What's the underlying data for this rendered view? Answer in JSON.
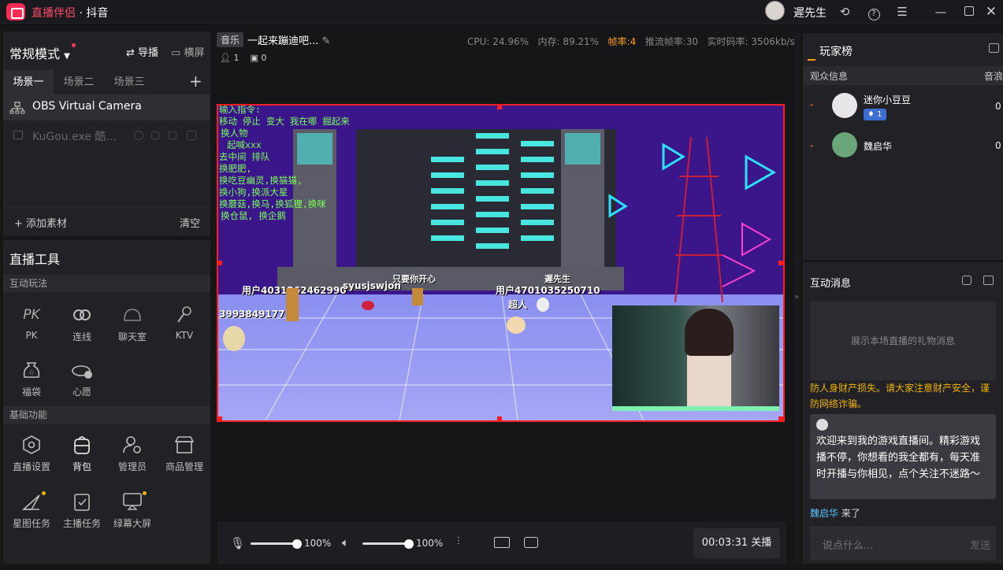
{
  "app": {
    "name": "直播伴侣",
    "subtitle": "· 抖音"
  },
  "user": {
    "name": "遲先生"
  },
  "left": {
    "mode": "常规模式",
    "guide_label": "导播",
    "landscape_label": "横屏",
    "scene_tabs": [
      "场景一",
      "场景二",
      "场景三"
    ],
    "sources": [
      {
        "name": "OBS Virtual Camera"
      },
      {
        "name": "KuGou.exe 酷..."
      }
    ],
    "add_source": "添加素材",
    "clear": "清空",
    "tools_title": "直播工具",
    "section_interactive": "互动玩法",
    "interactive": [
      "PK",
      "连线",
      "聊天室",
      "KTV",
      "福袋",
      "心愿"
    ],
    "section_basic": "基础功能",
    "basic": [
      "直播设置",
      "背包",
      "管理员",
      "商品管理",
      "星图任务",
      "主播任务",
      "绿幕大屏"
    ]
  },
  "center": {
    "music_tag": "音乐",
    "title": "一起来蹦迪吧...",
    "cpu": "CPU: 24.96%",
    "mem": "内存: 89.21%",
    "fps": "帧率:4",
    "push_fps": "推流帧率:30",
    "bitrate": "实时码率: 3506kb/s",
    "viewers": "1",
    "gifts": "0",
    "preview": {
      "cmd_lines": [
        "输入指令:",
        "移动 停止 变大 我在哪 掘起来",
        "换人物",
        "起喊xxx",
        "去中间 排队",
        "换肥肥,",
        "换吃豆幽灵,换猫猫,",
        "换小狗,换派大星",
        "换蘑菇,换马,换狐狸,换咪",
        "换仓鼠, 换企鹅"
      ],
      "labels": [
        "用户4031262462990",
        "syusjswjoh",
        "只要你开心",
        "遲先生",
        "用户4701035250710",
        "超人",
        "3993849177"
      ]
    },
    "mic_volume": "100%",
    "speaker_volume": "100%",
    "timer": "00:03:31 关播"
  },
  "right": {
    "leaderboard_title": "玩家榜",
    "col_audience": "观众信息",
    "col_score": "音浪",
    "players": [
      {
        "rank": "-",
        "name": "迷你小豆豆",
        "badge": "1",
        "score": "0"
      },
      {
        "rank": "-",
        "name": "魏启华",
        "badge": "",
        "score": "0"
      }
    ],
    "messages_title": "互动消息",
    "gift_placeholder": "展示本场直播的礼物消息",
    "warning": "防人身财产损失。请大家注意财产安全，谨防网络诈骗。",
    "welcome": "欢迎来到我的游戏直播间。精彩游戏播不停，你想看的我全都有，每天准时开播与你相见，点个关注不迷路～",
    "join_user": "魏启华",
    "join_text": "来了",
    "input_placeholder": "说点什么...",
    "send": "发送"
  }
}
